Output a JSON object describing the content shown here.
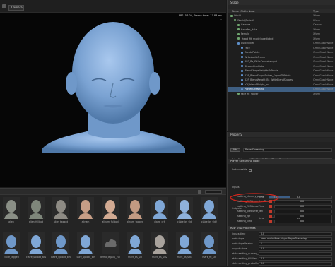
{
  "viewport": {
    "camera_label": "Camera",
    "fps_line1": "FPS: 56.04, Frame time: 17.84 ms",
    "fps_line2": "..."
  },
  "stage": {
    "title": "Stage",
    "col_name": "Name (Old to New)",
    "col_type": "Type",
    "rows": [
      {
        "name": "World",
        "type": "Xform",
        "indent": 0
      },
      {
        "name": "World_Default",
        "type": "Xform",
        "indent": 1
      },
      {
        "name": "Camera",
        "type": "Camera",
        "indent": 2
      },
      {
        "name": "transfer_data",
        "type": "Xform",
        "indent": 2
      },
      {
        "name": "Female",
        "type": "Xform",
        "indent": 2
      },
      {
        "name": "_head_fit_model_predicted",
        "type": "Xform",
        "indent": 2
      },
      {
        "name": "audioSlicer",
        "type": "OmniGraphNode",
        "indent": 2
      },
      {
        "name": "Face",
        "type": "OmniGraphNode",
        "indent": 3
      },
      {
        "name": "CreatePoints",
        "type": "OmniGraphNode",
        "indent": 3
      },
      {
        "name": "WriteAudioFrame",
        "type": "OmniGraphNode",
        "indent": 3
      },
      {
        "name": "A2F_Bs_WritePointsAsInput",
        "type": "OmniGraphNode",
        "indent": 3
      },
      {
        "name": "StreamLiveData",
        "type": "OmniGraphNode",
        "indent": 3
      },
      {
        "name": "BlendShapeWeightsToPoints",
        "type": "OmniGraphNode",
        "indent": 3
      },
      {
        "name": "A2F_BlendShapeSolver_ExportToPoints",
        "type": "OmniGraphNode",
        "indent": 3
      },
      {
        "name": "A2F_BlendWeight_Bs_WriteBlendShapes",
        "type": "OmniGraphNode",
        "indent": 3
      },
      {
        "name": "a2f_blendWeight_bs",
        "type": "OmniGraphNode",
        "indent": 3
      },
      {
        "name": "PlayerStreaming",
        "type": "OmniGraphNode",
        "indent": 3,
        "selected": true
      },
      {
        "name": "face_fit_solver",
        "type": "Xform",
        "indent": 2
      }
    ]
  },
  "props": {
    "title": "Property",
    "add_label": "Add",
    "prim_name": "PlayerStreaming",
    "prim_path_label": "Prim Path",
    "prim_path": "/World/audio2face/PlayerStreaming",
    "instanceable_label": "Instanceable",
    "node_section": "Player Streaming Node",
    "inputs_label": "Inputs",
    "outputs_label": "Outputs",
    "state_label": "State",
    "time_label": "time",
    "time_value": "0.0",
    "out_time_label": "time",
    "out_time_value": "0.0",
    "state_rows": [
      {
        "label": "setting_dummy_player",
        "kind": "check"
      },
      {
        "label": "setting_fillSilenceUserTime",
        "kind": "num",
        "value": "0.0"
      },
      {
        "label": "setting_fillSilenceTime",
        "kind": "num",
        "value": "0.0"
      },
      {
        "label": "setting_prebuffer_len",
        "kind": "num",
        "value": "0.0"
      },
      {
        "label": "setting_fpr",
        "kind": "num",
        "value": "0.0"
      },
      {
        "label": "setting_time",
        "kind": "num",
        "value": "0.0"
      }
    ],
    "raw_section": "Raw USD Properties",
    "raw_rows": [
      {
        "label": "inputs:time",
        "value": "0.0"
      },
      {
        "label": "node:type",
        "value": "omni.audio2face.player.PlayerStreaming"
      },
      {
        "label": "node:typeVersion",
        "value": "1"
      },
      {
        "label": "outputs:time",
        "value": "0.0"
      },
      {
        "label": "state:setting_dummy_pl",
        "value": ""
      },
      {
        "label": "state:setting_fillSilen",
        "value": "0.0"
      },
      {
        "label": "state:setting_prebuffer_len",
        "value": "0.0"
      }
    ]
  },
  "browser": {
    "row1": [
      "alien",
      "alien_fullbod",
      "alien_tagged",
      "alinam",
      "alinam_fullbod",
      "alinam_tagged",
      "claire_crit",
      "claire_bs_sld",
      "claire_bs_sld2"
    ],
    "row2": [
      "claire_tagged",
      "claire_upload_adv",
      "claire_upload_blnd",
      "claire_upload_blnd",
      "demo_legacy_2048",
      "mark_bs_sld",
      "mark_bs_sld2",
      "mark_bs_sld3",
      "mark_fit_sld"
    ]
  },
  "colors": {
    "accent": "#3f5f82",
    "annotation": "#d9261c",
    "head": "#7fa7d6"
  }
}
